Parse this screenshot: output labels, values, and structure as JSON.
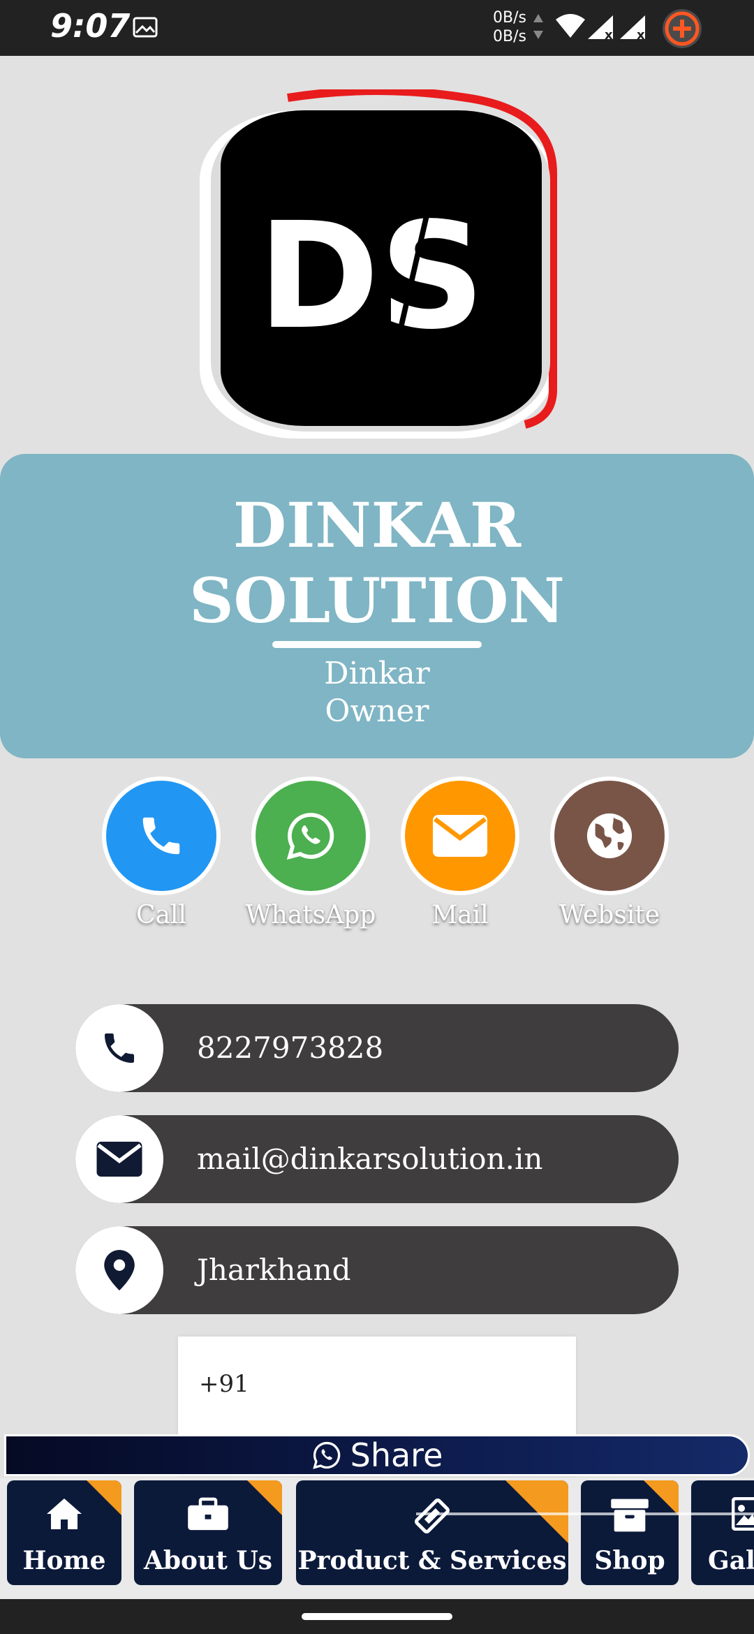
{
  "status_bar": {
    "time": "9:07",
    "speed_up": "0B/s",
    "speed_down": "0B/s",
    "icons": [
      "image-icon",
      "wifi-icon",
      "signal-icon",
      "signal-icon",
      "screen-record-icon"
    ]
  },
  "logo": {
    "text": "DS",
    "ring_accent": "#e81c1c"
  },
  "profile": {
    "company_line1": "DINKAR",
    "company_line2": "SOLUTION",
    "name": "Dinkar",
    "role": "Owner",
    "card_color": "#7fb5c4"
  },
  "actions": [
    {
      "label": "Call",
      "icon": "phone-icon",
      "color": "#2196f3"
    },
    {
      "label": "WhatsApp",
      "icon": "whatsapp-icon",
      "color": "#4caf50"
    },
    {
      "label": "Mail",
      "icon": "mail-icon",
      "color": "#ff9800"
    },
    {
      "label": "Website",
      "icon": "globe-icon",
      "color": "#795548"
    }
  ],
  "contacts": [
    {
      "icon": "phone-icon",
      "value": "8227973828"
    },
    {
      "icon": "mail-icon",
      "value": "mail@dinkarsolution.in"
    },
    {
      "icon": "location-pin-icon",
      "value": "Jharkhand"
    }
  ],
  "phone_input": {
    "prefix": "+91"
  },
  "share": {
    "label": "Share",
    "icon": "whatsapp-icon"
  },
  "bottom_nav": [
    {
      "label": "Home",
      "icon": "home-icon"
    },
    {
      "label": "About Us",
      "icon": "briefcase-icon"
    },
    {
      "label": "Product & Services",
      "icon": "ticket-icon"
    },
    {
      "label": "Shop",
      "icon": "box-icon"
    },
    {
      "label": "Gall",
      "icon": "gallery-icon"
    }
  ],
  "colors": {
    "nav_bg": "#0c1a3a",
    "nav_corner": "#f39a1f",
    "contact_bg": "#3f3d3e"
  }
}
